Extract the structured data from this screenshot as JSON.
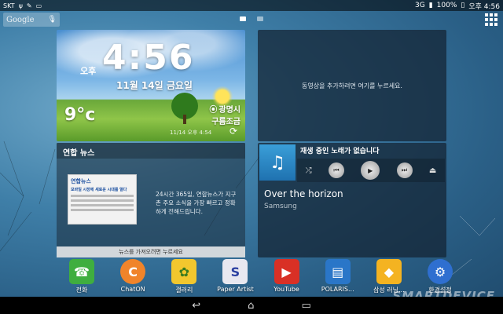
{
  "status_bar": {
    "carrier": "SKT",
    "network": "3G",
    "battery": "100%",
    "time": "오후 4:56"
  },
  "google_bar": {
    "label": "Google"
  },
  "weather": {
    "ampm": "오후",
    "clock": "4:56",
    "date": "11월 14일 금요일",
    "temperature": "9°c",
    "city": "광명시",
    "condition": "구름조금",
    "updated": "11/14 오후 4:54"
  },
  "news": {
    "title": "연합 뉴스",
    "paper_logo": "연합뉴스",
    "paper_headline": "모바일 시장에 새로운 시대를 열다",
    "description": "24시간 365일, 연합뉴스가 지구촌 주요 소식을 가장 빠르고 정확하게 전해드립니다.",
    "footer": "뉴스를 가져오려면 누르세요"
  },
  "video": {
    "prompt": "동영상을 추가하려면 여기를 누르세요."
  },
  "music": {
    "status": "재생 중인 노래가 없습니다",
    "track": "Over the horizon",
    "artist": "Samsung"
  },
  "dock": [
    {
      "label": "전화",
      "icon": "phone-icon",
      "color": "#3fae3f",
      "glyph": "☎"
    },
    {
      "label": "ChatON",
      "icon": "chaton-icon",
      "color": "#f0842a",
      "glyph": "C"
    },
    {
      "label": "갤러리",
      "icon": "gallery-icon",
      "color": "#f2c72e",
      "glyph": "✿"
    },
    {
      "label": "Paper Artist",
      "icon": "paper-artist-icon",
      "color": "#e8e8f0",
      "glyph": "S"
    },
    {
      "label": "YouTube",
      "icon": "youtube-icon",
      "color": "#d93025",
      "glyph": "▶"
    },
    {
      "label": "POLARIS...",
      "icon": "polaris-icon",
      "color": "#2a76c8",
      "glyph": "▤"
    },
    {
      "label": "삼성 러닝...",
      "icon": "samsung-learning-icon",
      "color": "#f4b321",
      "glyph": "◆"
    },
    {
      "label": "환경설정",
      "icon": "settings-icon",
      "color": "#2f6fd0",
      "glyph": "⚙"
    }
  ],
  "watermark": "SMARTDEVICE",
  "navbar": {
    "back": "↩",
    "home": "⌂",
    "recent": "▭"
  }
}
